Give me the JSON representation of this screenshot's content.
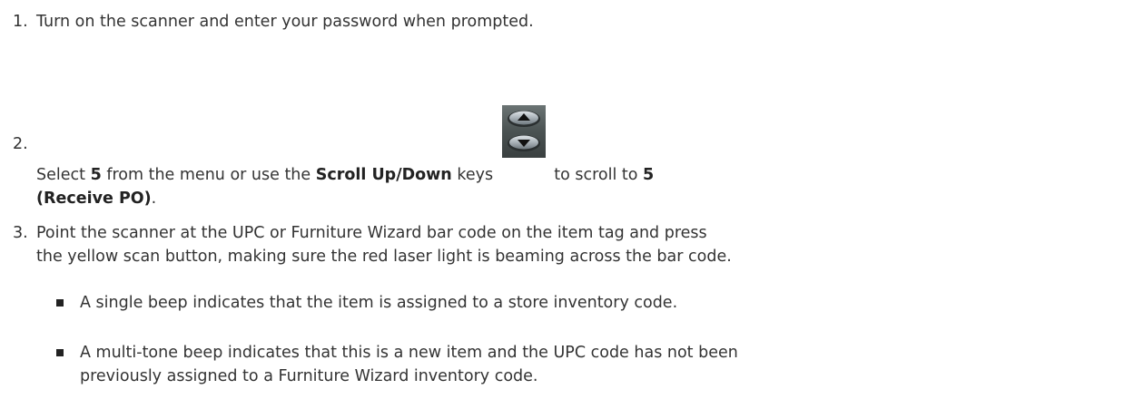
{
  "steps": [
    {
      "number": "1.",
      "text": "Turn on the scanner and enter your password when prompted."
    },
    {
      "number": "2.",
      "text_before": "Select ",
      "bold_option": "5",
      "text_mid1": " from the menu or use the ",
      "bold_keys": "Scroll Up/Down",
      "text_mid2": " keys ",
      "keys_icon": "scroll-up-down-keys-icon",
      "text_after": " to scroll to ",
      "bold_target": "5",
      "bold_target_line2": "(Receive PO)",
      "period": "."
    },
    {
      "number": "3.",
      "line1": "Point the scanner at the UPC or Furniture Wizard bar code on the item tag and press",
      "line2": "the yellow scan button, making sure the red laser light is beaming across the bar code."
    }
  ],
  "bullets": [
    {
      "line1": "A single beep indicates that the item is assigned to a store inventory code."
    },
    {
      "line1": "A multi-tone beep indicates that this is a new item and the UPC code has not been",
      "line2": "previously assigned to a Furniture Wizard inventory code."
    }
  ]
}
